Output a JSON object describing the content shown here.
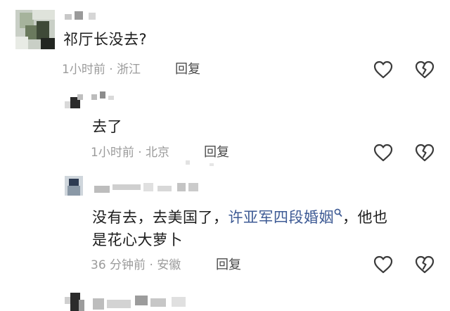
{
  "comments": [
    {
      "text": "祁厅长没去?",
      "time": "1小时前",
      "sep": "·",
      "location": "浙江",
      "reply_label": "回复"
    },
    {
      "text": "去了",
      "time": "1小时前",
      "sep": "·",
      "location": "北京",
      "reply_label": "回复"
    },
    {
      "text_before": "没有去，去美国了，",
      "link_text": "许亚军四段婚姻",
      "text_after_line1": "，他也",
      "text_line2": "是花心大萝卜",
      "time": "36 分钟前",
      "sep": "·",
      "location": "安徽",
      "reply_label": "回复"
    }
  ],
  "icons": {
    "like": "heart-outline-icon",
    "dislike": "broken-heart-icon",
    "search": "search-icon"
  },
  "colors": {
    "text": "#1c1c1c",
    "meta": "#9b9b9b",
    "link": "#3d5a94",
    "icon": "#3a3a3a"
  }
}
